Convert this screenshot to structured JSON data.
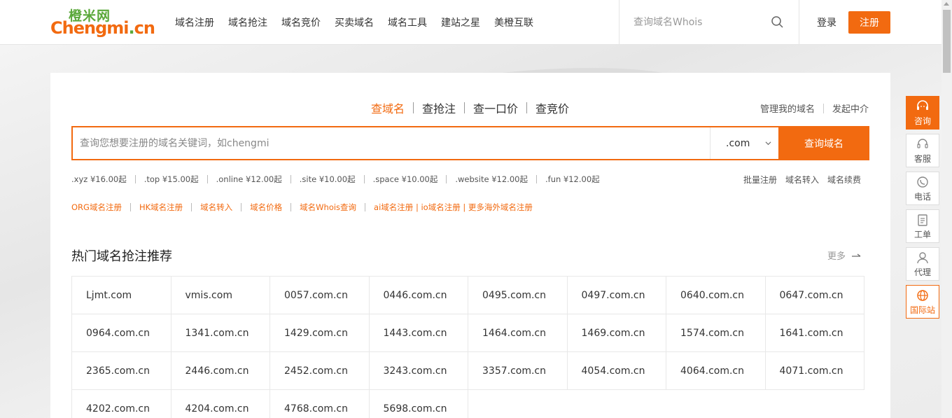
{
  "logo": {
    "cn": "橙米网",
    "en_main": "Chengmi",
    "en_dot": ".",
    "en_tld": "cn"
  },
  "nav": [
    "域名注册",
    "域名抢注",
    "域名竞价",
    "买卖域名",
    "域名工具",
    "建站之星",
    "美橙互联"
  ],
  "header": {
    "search_placeholder": "查询域名Whois",
    "login": "登录",
    "register": "注册"
  },
  "query_tabs": [
    "查域名",
    "查抢注",
    "查一口价",
    "查竞价"
  ],
  "manage_links": [
    "管理我的域名",
    "发起中介"
  ],
  "main_search": {
    "placeholder": "查询您想要注册的域名关键词，如chengmi",
    "tld": ".com",
    "button": "查询域名"
  },
  "prices": [
    ".xyz ¥16.00起",
    ".top ¥15.00起",
    ".online ¥12.00起",
    ".site ¥10.00起",
    ".space ¥10.00起",
    ".website ¥12.00起",
    ".fun ¥12.00起"
  ],
  "quick_links": [
    "批量注册",
    "域名转入",
    "域名续费"
  ],
  "org_links": [
    "ORG域名注册",
    "HK域名注册",
    "域名转入",
    "域名价格",
    "域名Whois查询",
    "ai域名注册 | io域名注册 | 更多海外域名注册"
  ],
  "hot": {
    "title": "热门域名抢注推荐",
    "more": "更多",
    "domains": [
      "Ljmt.com",
      "vmis.com",
      "0057.com.cn",
      "0446.com.cn",
      "0495.com.cn",
      "0497.com.cn",
      "0640.com.cn",
      "0647.com.cn",
      "0964.com.cn",
      "1341.com.cn",
      "1429.com.cn",
      "1443.com.cn",
      "1464.com.cn",
      "1469.com.cn",
      "1574.com.cn",
      "1641.com.cn",
      "2365.com.cn",
      "2446.com.cn",
      "2452.com.cn",
      "3243.com.cn",
      "3357.com.cn",
      "4054.com.cn",
      "4064.com.cn",
      "4071.com.cn",
      "4202.com.cn",
      "4204.com.cn",
      "4768.com.cn",
      "5698.com.cn"
    ]
  },
  "sidebar": [
    {
      "label": "咨询",
      "icon": "headset-icon"
    },
    {
      "label": "客服",
      "icon": "support-icon"
    },
    {
      "label": "电话",
      "icon": "phone-icon"
    },
    {
      "label": "工单",
      "icon": "ticket-icon"
    },
    {
      "label": "代理",
      "icon": "agent-icon"
    },
    {
      "label": "国际站",
      "icon": "globe-icon"
    }
  ],
  "colors": {
    "accent": "#f26a10",
    "green": "#5aa83a"
  }
}
